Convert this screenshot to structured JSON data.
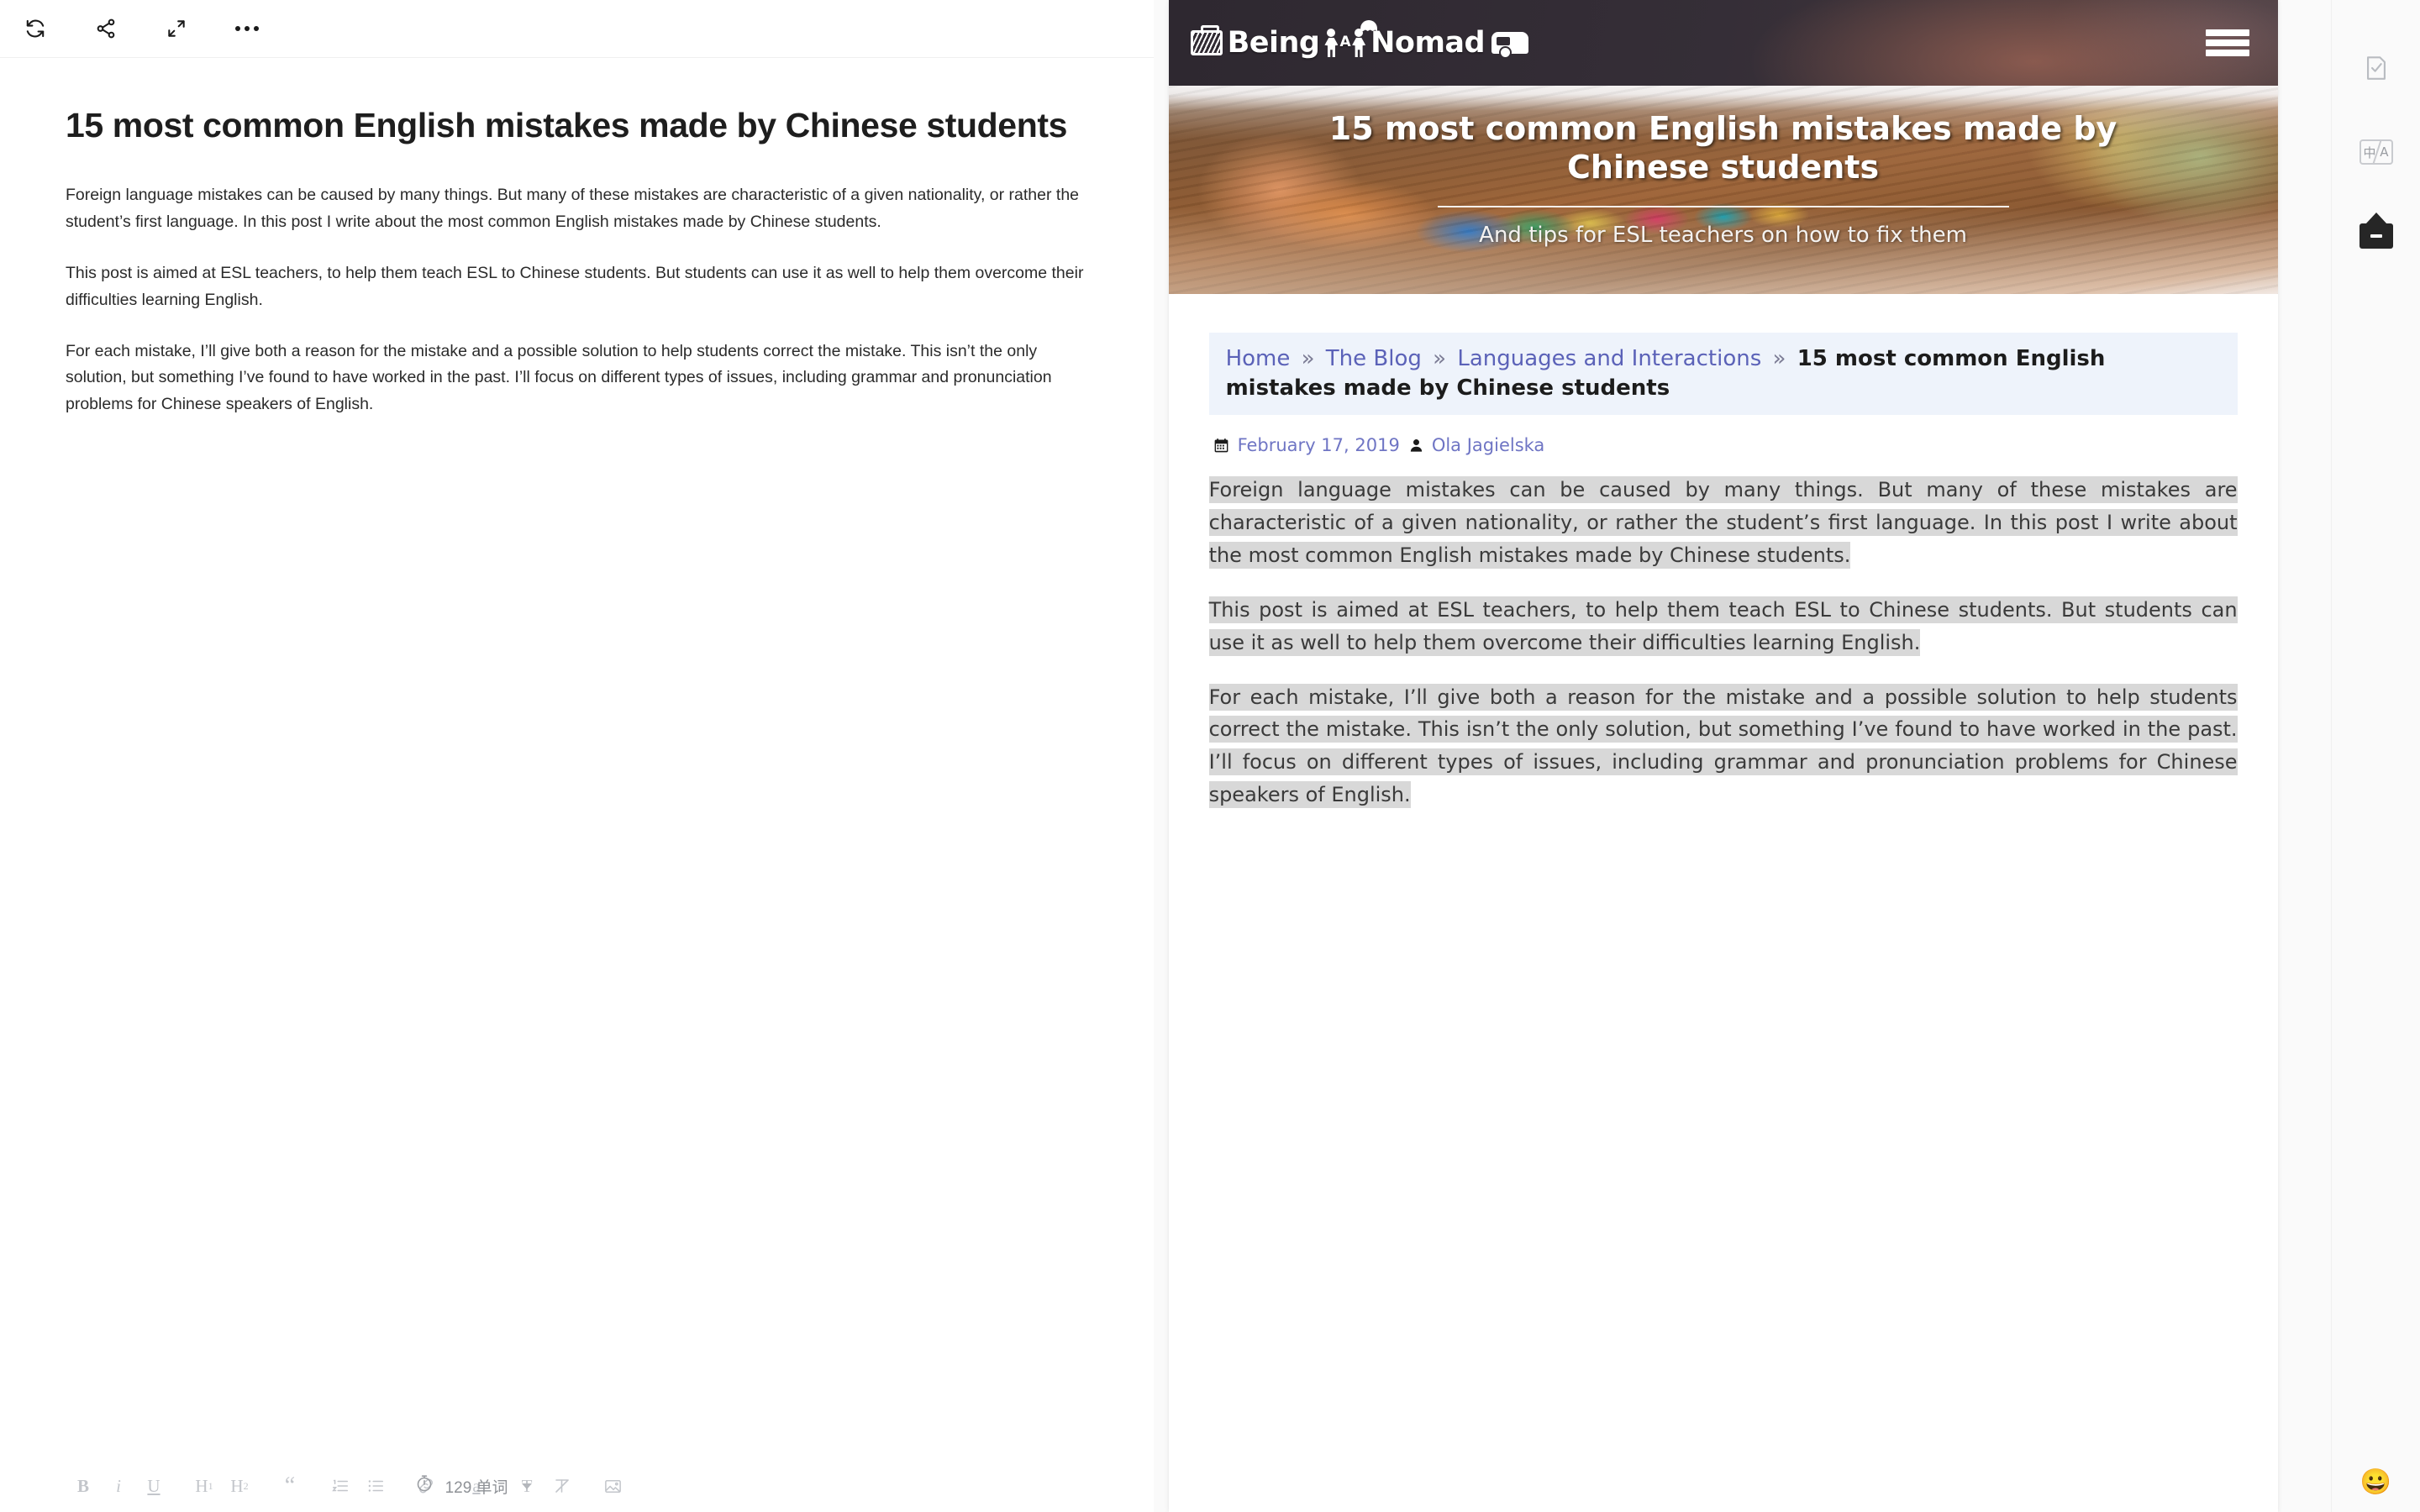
{
  "editor": {
    "toolbar": {
      "sync_label": "sync",
      "share_label": "share",
      "fullscreen_label": "fullscreen",
      "more_label": "more"
    },
    "document": {
      "title": "15 most common English mistakes made by Chinese students",
      "paragraphs": [
        "Foreign language mistakes can be caused by many things. But many of these mistakes are characteristic of a given nationality, or rather the student’s first language. In this post I write about the most common English mistakes made by Chinese students.",
        "This post is aimed at ESL teachers, to help them teach ESL to Chinese students. But students can use it as well to help them overcome their difficulties learning English.",
        "For each mistake, I’ll give both a reason for the mistake and a possible solution to help students correct the mistake. This isn’t the only solution, but something I’ve found to have worked in the past. I’ll focus on different types of issues, including grammar and pronunciation problems for Chinese speakers of English."
      ]
    },
    "format_toolbar": {
      "bold": "B",
      "italic": "i",
      "underline": "U",
      "heading1": "H",
      "heading1_sub": "1",
      "heading2": "H",
      "heading2_sub": "2",
      "quote": "“",
      "ordered_list": "ordered-list",
      "unordered_list": "unordered-list",
      "link": "link",
      "highlight": "a",
      "text_style": "T",
      "clear_format": "clear-format",
      "image": "image"
    },
    "status": {
      "word_count": "129 单词"
    }
  },
  "preview": {
    "site": {
      "logo_text_1": "Being",
      "logo_letter": "A",
      "logo_text_2": "Nomad",
      "menu_label": "menu"
    },
    "hero": {
      "title": "15 most common English mistakes made by Chinese students",
      "subtitle": "And tips for ESL teachers on how to fix them"
    },
    "breadcrumb": {
      "items": [
        {
          "label": "Home",
          "current": false
        },
        {
          "label": "The Blog",
          "current": false
        },
        {
          "label": "Languages and Interactions",
          "current": false
        },
        {
          "label": "15 most common English mistakes made by Chinese students",
          "current": true
        }
      ],
      "separator": "»"
    },
    "meta": {
      "date": "February 17, 2019",
      "author": "Ola Jagielska"
    },
    "paragraphs": [
      "Foreign language mistakes can be caused by many things. But many of these mistakes are characteristic of a given nationality, or rather the student’s first language. In this post I write about the most common English mistakes made by Chinese students.",
      "This post is aimed at ESL teachers, to help them teach ESL to Chinese students. But students can use it as well to help them overcome their difficulties learning English.",
      "For each mistake, I’ll give both a reason for the mistake and a possible solution to help students correct the mistake. This isn’t the only solution, but something I’ve found to have worked in the past. I’ll focus on different types of issues, including grammar and pronunciation problems for Chinese speakers of English."
    ]
  },
  "rail": {
    "spellcheck_label": "spell-check",
    "translate_cn": "中",
    "translate_en": "A",
    "toolbox_label": "toolbox",
    "emoji": "😀"
  },
  "colors": {
    "accent_link": "#5b62b8",
    "breadcrumb_bg": "#eef3fb",
    "highlight": "#d8d8d8",
    "header_bg": "#312b33"
  }
}
